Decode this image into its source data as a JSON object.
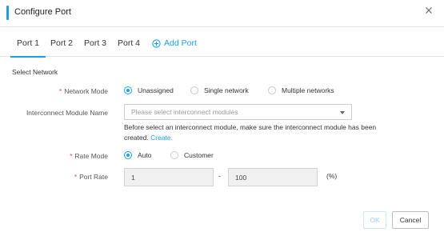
{
  "dialog": {
    "title": "Configure Port"
  },
  "tabs": [
    {
      "label": "Port 1",
      "active": true
    },
    {
      "label": "Port 2",
      "active": false
    },
    {
      "label": "Port 3",
      "active": false
    },
    {
      "label": "Port 4",
      "active": false
    }
  ],
  "add_port_label": "Add Port",
  "section_title": "Select Network",
  "network_mode": {
    "label": "Network Mode",
    "required_mark": "*",
    "options": [
      "Unassigned",
      "Single network",
      "Multiple networks"
    ],
    "selected": "Unassigned"
  },
  "interconnect_module": {
    "label": "Interconnect Module Name",
    "placeholder": "Please select interconnect modules",
    "help_text": "Before select an interconnect module, make sure the interconnect module has been created.",
    "help_link": "Create."
  },
  "rate_mode": {
    "label": "Rate Mode",
    "required_mark": "*",
    "options": [
      "Auto",
      "Customer"
    ],
    "selected": "Auto"
  },
  "port_rate": {
    "label": "Port Rate",
    "required_mark": "*",
    "min_value": "1",
    "separator": "-",
    "max_value": "100",
    "unit": "(%)"
  },
  "buttons": {
    "ok": "OK",
    "cancel": "Cancel"
  },
  "colors": {
    "accent": "#1e9fe0",
    "required": "#e5484d"
  }
}
